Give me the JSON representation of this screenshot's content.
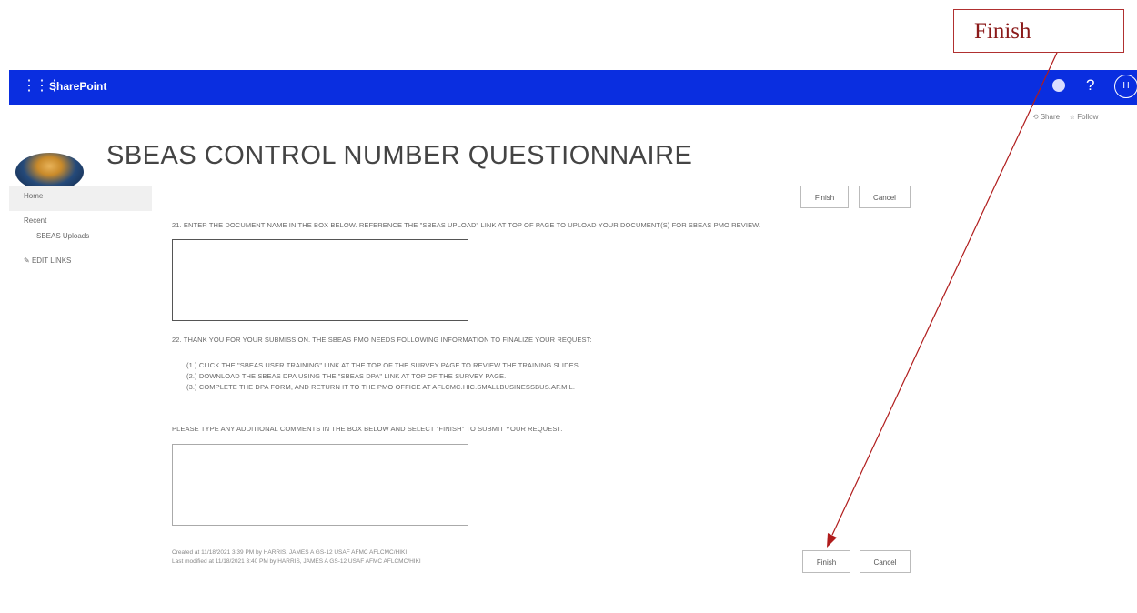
{
  "callout": {
    "label": "Finish"
  },
  "suite_bar": {
    "brand": "SharePoint",
    "help": "?",
    "avatar": "H",
    "color": "#0a2ee0"
  },
  "page_actions": {
    "share": "Share",
    "follow": "Follow"
  },
  "title": "SBEAS CONTROL NUMBER QUESTIONNAIRE",
  "nav": {
    "home": "Home",
    "recent": "Recent",
    "sbeas_uploads": "SBEAS Uploads",
    "edit_links": "EDIT LINKS"
  },
  "buttons": {
    "finish": "Finish",
    "cancel": "Cancel"
  },
  "questions": {
    "q21": "21. ENTER THE DOCUMENT NAME IN THE BOX BELOW. REFERENCE THE \"SBEAS UPLOAD\" LINK AT TOP OF PAGE TO UPLOAD YOUR DOCUMENT(S) FOR SBEAS PMO REVIEW.",
    "q22": "22. THANK YOU FOR YOUR SUBMISSION. THE SBEAS PMO NEEDS FOLLOWING INFORMATION TO FINALIZE YOUR REQUEST:",
    "step1": "(1.) CLICK THE \"SBEAS USER TRAINING\" LINK AT THE TOP OF THE SURVEY PAGE TO REVIEW THE TRAINING SLIDES.",
    "step2": "(2.) DOWNLOAD THE SBEAS DPA USING THE \"SBEAS DPA\" LINK AT TOP OF THE SURVEY PAGE.",
    "step3": "(3.) COMPLETE THE DPA FORM, AND RETURN IT TO THE PMO OFFICE AT AFLCMC.HIC.SMALLBUSINESSBUS.AF.MIL.",
    "comments": "PLEASE TYPE ANY ADDITIONAL COMMENTS IN THE BOX BELOW AND SELECT \"FINISH\" TO SUBMIT YOUR REQUEST."
  },
  "meta": {
    "created": "Created at 11/18/2021 3:39 PM by HARRIS, JAMES A GS-12 USAF AFMC AFLCMC/HIKI",
    "modified": "Last modified at 11/18/2021 3:40 PM by HARRIS, JAMES A GS-12 USAF AFMC AFLCMC/HIKI"
  },
  "colors": {
    "annotation": "#b01c1c"
  }
}
